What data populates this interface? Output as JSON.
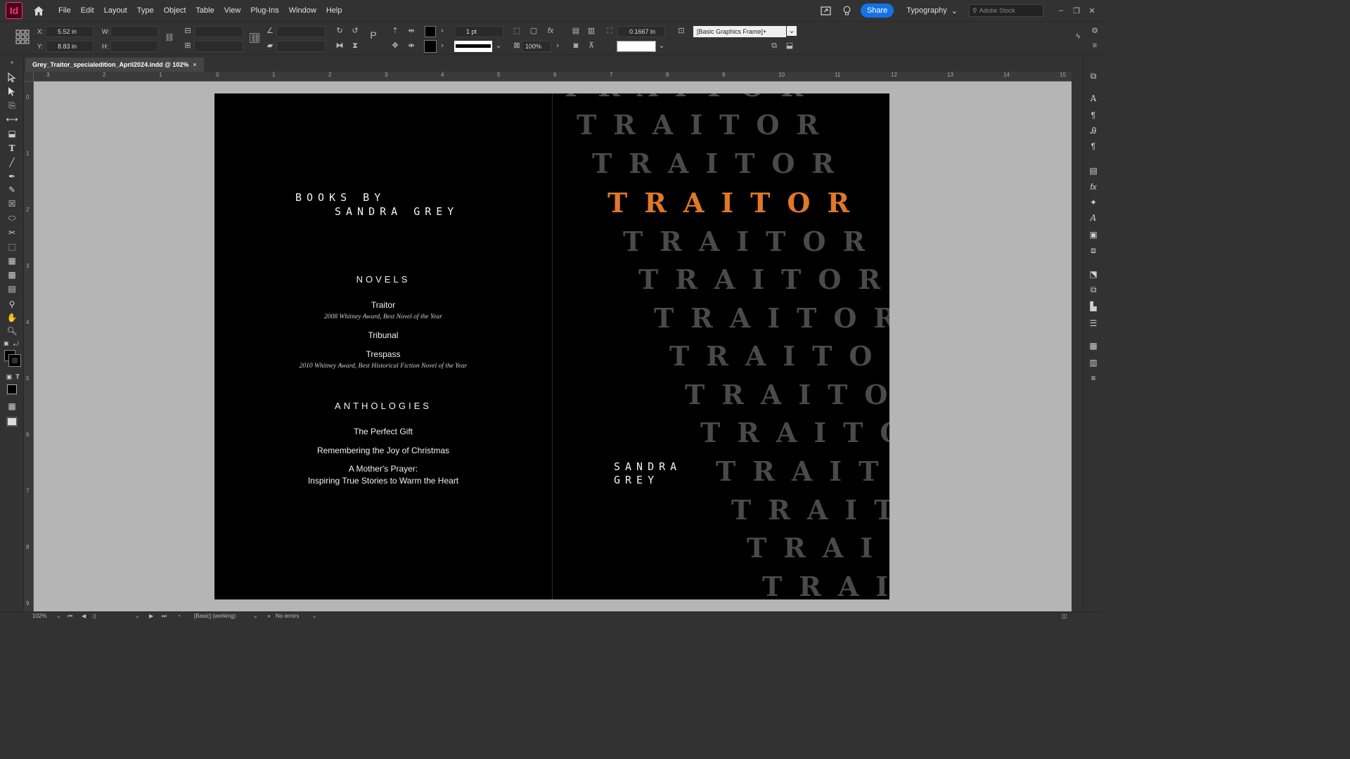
{
  "app": {
    "logo_text": "Id"
  },
  "menu": [
    "File",
    "Edit",
    "Layout",
    "Type",
    "Object",
    "Table",
    "View",
    "Plug-Ins",
    "Window",
    "Help"
  ],
  "header_right": {
    "share_label": "Share",
    "workspace_label": "Typography",
    "stock_placeholder": "Adobe Stock"
  },
  "control_panel": {
    "x_label": "X:",
    "x_value": "5.52 in",
    "y_label": "Y:",
    "y_value": "8.83 in",
    "w_label": "W:",
    "h_label": "H:",
    "stroke_weight": "1 pt",
    "opacity": "100%",
    "offset_value": "0.1667 in",
    "object_style": "[Basic Graphics Frame]+"
  },
  "document_tab": {
    "title": "Grey_Traitor_specialedition_April2024.indd @ 102%",
    "close": "×"
  },
  "ruler": {
    "h_labels": [
      "3",
      "2",
      "1",
      "0",
      "1",
      "2",
      "3",
      "4",
      "5",
      "6",
      "7",
      "8",
      "9",
      "10",
      "11",
      "12",
      "13",
      "14",
      "15"
    ],
    "v_labels": [
      "0",
      "1",
      "2",
      "3",
      "4",
      "5",
      "6",
      "7",
      "8",
      "9"
    ]
  },
  "left_page": {
    "books_by_line1": "BOOKS BY",
    "books_by_line2": "SANDRA GREY",
    "novels_heading": "NOVELS",
    "novels": [
      {
        "title": "Traitor",
        "award": "2008 Whitney Award, Best Novel of the Year"
      },
      {
        "title": "Tribunal",
        "award": ""
      },
      {
        "title": "Trespass",
        "award": "2010 Whitney Award, Best Historical Fiction Novel of the Year"
      }
    ],
    "anthologies_heading": "ANTHOLOGIES",
    "anthologies": [
      "The Perfect Gift",
      "Remembering the Joy of Christmas",
      "A Mother's Prayer:",
      "Inspiring True Stories to Warm the Heart"
    ]
  },
  "right_page": {
    "repeated_word": "TRAITOR",
    "highlight_color": "#e0782a",
    "author_line1": "SANDRA",
    "author_line2": "GREY"
  },
  "status_bar": {
    "zoom": "102%",
    "preflight_profile": "[Basic] (working)",
    "errors": "No errors"
  }
}
